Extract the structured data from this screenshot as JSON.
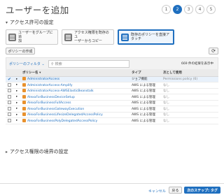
{
  "page": {
    "title": "ユーザーを追加"
  },
  "steps": [
    "1",
    "2",
    "3",
    "4",
    "5"
  ],
  "permissions": {
    "section_title": "アクセス許可の設定",
    "options": [
      {
        "label_line1": "ユーザーをグループに追",
        "label_line2": "加"
      },
      {
        "label_line1": "アクセス権限を既存のユ",
        "label_line2": "ーザーからコピー"
      },
      {
        "label_line1": "既存のポリシーを直接ア",
        "label_line2": "タッチ"
      }
    ],
    "create_policy_label": "ポリシーの作成",
    "refresh_icon": "refresh-icon"
  },
  "toolbar": {
    "filter_label": "ポリシーのフィルタ ⌄",
    "search_placeholder": "検索",
    "result_count": "669 件の結果を表示中"
  },
  "table": {
    "headers": {
      "name": "ポリシー名 ▾",
      "type": "タイプ",
      "used_as": "次として使用"
    },
    "rows": [
      {
        "checked": true,
        "name": "AdministratorAccess",
        "type": "ジョブ機能",
        "used": "Permissions policy (6)"
      },
      {
        "checked": false,
        "name": "AdministratorAccess-Amplify",
        "type": "AWS による管理",
        "used": "なし"
      },
      {
        "checked": false,
        "name": "AdministratorAccess-AWSElasticBeanstalk",
        "type": "AWS による管理",
        "used": "なし"
      },
      {
        "checked": false,
        "name": "AlexaForBusinessDeviceSetup",
        "type": "AWS による管理",
        "used": "なし"
      },
      {
        "checked": false,
        "name": "AlexaForBusinessFullAccess",
        "type": "AWS による管理",
        "used": "なし"
      },
      {
        "checked": false,
        "name": "AlexaForBusinessGatewayExecution",
        "type": "AWS による管理",
        "used": "なし"
      },
      {
        "checked": false,
        "name": "AlexaForBusinessLifesizeDelegatedAccessPolicy",
        "type": "AWS による管理",
        "used": "なし"
      },
      {
        "checked": false,
        "name": "AlexaForBusinessPolyDelegatedAccessPolicy",
        "type": "AWS による管理",
        "used": "なし"
      }
    ]
  },
  "boundary": {
    "section_title": "アクセス権限の境界の設定"
  },
  "footer": {
    "cancel": "キャンセル",
    "back": "戻る",
    "next": "次のステップ: タグ"
  }
}
